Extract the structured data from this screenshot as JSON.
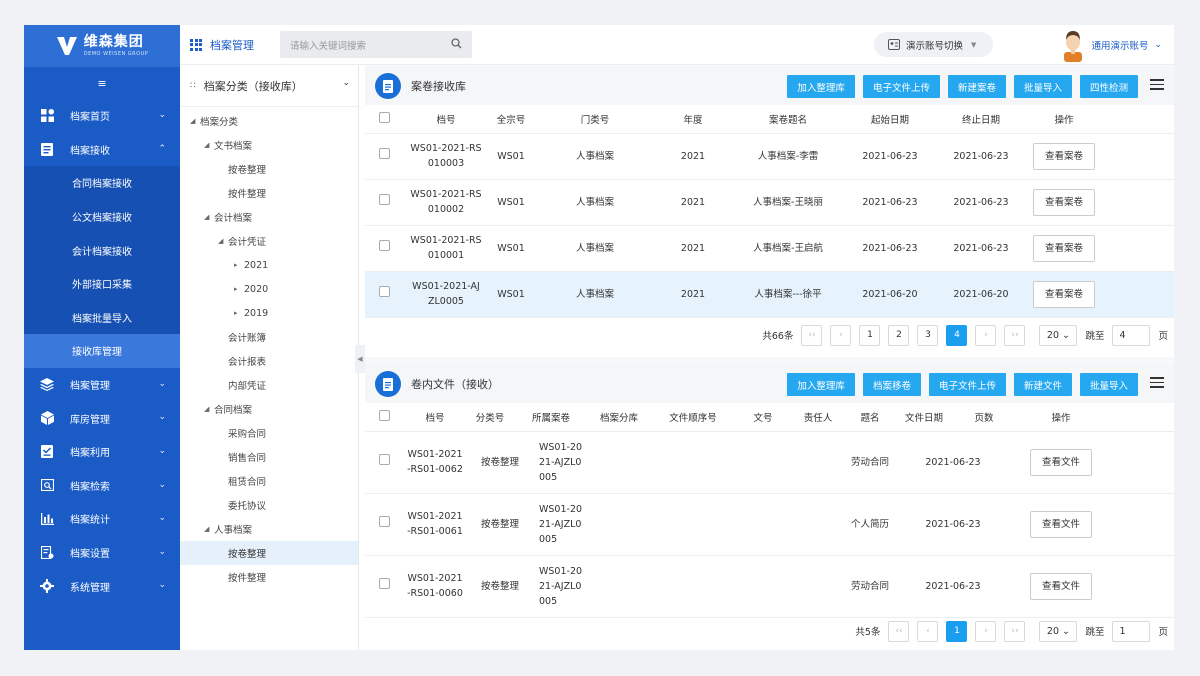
{
  "brand": {
    "name": "维森集团",
    "sub": "DEMO WEISEN GROUP"
  },
  "topbar": {
    "title": "档案管理",
    "search_placeholder": "请输入关键词搜索",
    "switch_label": "演示账号切换",
    "user": "通用演示账号"
  },
  "sidebar": {
    "collapse_icon": "≡",
    "items": [
      {
        "label": "档案首页",
        "icon": "dashboard-icon"
      },
      {
        "label": "档案接收",
        "icon": "book-icon"
      },
      {
        "label": "档案管理",
        "icon": "layers-icon"
      },
      {
        "label": "库房管理",
        "icon": "cube-icon"
      },
      {
        "label": "档案利用",
        "icon": "checklist-icon"
      },
      {
        "label": "档案检索",
        "icon": "search-doc-icon"
      },
      {
        "label": "档案统计",
        "icon": "bar-chart-icon"
      },
      {
        "label": "档案设置",
        "icon": "settings-doc-icon"
      },
      {
        "label": "系统管理",
        "icon": "gear-icon"
      }
    ],
    "sub_items": [
      "合同档案接收",
      "公文档案接收",
      "会计档案接收",
      "外部接口采集",
      "档案批量导入",
      "接收库管理"
    ]
  },
  "tree": {
    "title": "档案分类（接收库）",
    "nodes": [
      "档案分类",
      "文书档案",
      "按卷整理",
      "按件整理",
      "会计档案",
      "会计凭证",
      "2021",
      "2020",
      "2019",
      "会计账簿",
      "会计报表",
      "内部凭证",
      "合同档案",
      "采购合同",
      "销售合同",
      "租赁合同",
      "委托协议",
      "人事档案",
      "按卷整理",
      "按件整理"
    ]
  },
  "panel1": {
    "title": "案卷接收库",
    "buttons": [
      "加入整理库",
      "电子文件上传",
      "新建案卷",
      "批量导入",
      "四性检测"
    ],
    "columns": [
      "档号",
      "全宗号",
      "门类号",
      "年度",
      "案卷题名",
      "起始日期",
      "终止日期",
      "操作"
    ],
    "rows": [
      {
        "no": "WS01-2021-RS010003",
        "fonds": "WS01",
        "cat": "人事档案",
        "year": "2021",
        "title": "人事档案-李雷",
        "start": "2021-06-23",
        "end": "2021-06-23",
        "action": "查看案卷"
      },
      {
        "no": "WS01-2021-RS010002",
        "fonds": "WS01",
        "cat": "人事档案",
        "year": "2021",
        "title": "人事档案-王晓丽",
        "start": "2021-06-23",
        "end": "2021-06-23",
        "action": "查看案卷"
      },
      {
        "no": "WS01-2021-RS010001",
        "fonds": "WS01",
        "cat": "人事档案",
        "year": "2021",
        "title": "人事档案-王启航",
        "start": "2021-06-23",
        "end": "2021-06-23",
        "action": "查看案卷"
      },
      {
        "no": "WS01-2021-AJZL0005",
        "fonds": "WS01",
        "cat": "人事档案",
        "year": "2021",
        "title": "人事档案---徐平",
        "start": "2021-06-20",
        "end": "2021-06-20",
        "action": "查看案卷"
      }
    ],
    "pager": {
      "total": "共66条",
      "pages": [
        "1",
        "2",
        "3",
        "4"
      ],
      "current": "4",
      "size": "20",
      "jump_label": "跳至",
      "jump_value": "4",
      "page_unit": "页"
    }
  },
  "panel2": {
    "title": "卷内文件（接收）",
    "buttons": [
      "加入整理库",
      "档案移卷",
      "电子文件上传",
      "新建文件",
      "批量导入"
    ],
    "columns": [
      "档号",
      "分类号",
      "所属案卷",
      "档案分库",
      "文件顺序号",
      "文号",
      "责任人",
      "题名",
      "文件日期",
      "页数",
      "操作"
    ],
    "rows": [
      {
        "no": "WS01-2021-RS01-0062",
        "cls": "按卷整理",
        "vol": "WS01-2021-AJZL0005",
        "title": "劳动合同",
        "date": "2021-06-23",
        "action": "查看文件"
      },
      {
        "no": "WS01-2021-RS01-0061",
        "cls": "按卷整理",
        "vol": "WS01-2021-AJZL0005",
        "title": "个人简历",
        "date": "2021-06-23",
        "action": "查看文件"
      },
      {
        "no": "WS01-2021-RS01-0060",
        "cls": "按卷整理",
        "vol": "WS01-2021-AJZL0005",
        "title": "劳动合同",
        "date": "2021-06-23",
        "action": "查看文件"
      }
    ],
    "pager": {
      "total": "共5条",
      "pages": [
        "1"
      ],
      "current": "1",
      "size": "20",
      "jump_label": "跳至",
      "jump_value": "1",
      "page_unit": "页"
    }
  },
  "colors": {
    "primary": "#1a5bc5",
    "accent": "#26a8f0",
    "active_page": "#1a9ff0"
  }
}
